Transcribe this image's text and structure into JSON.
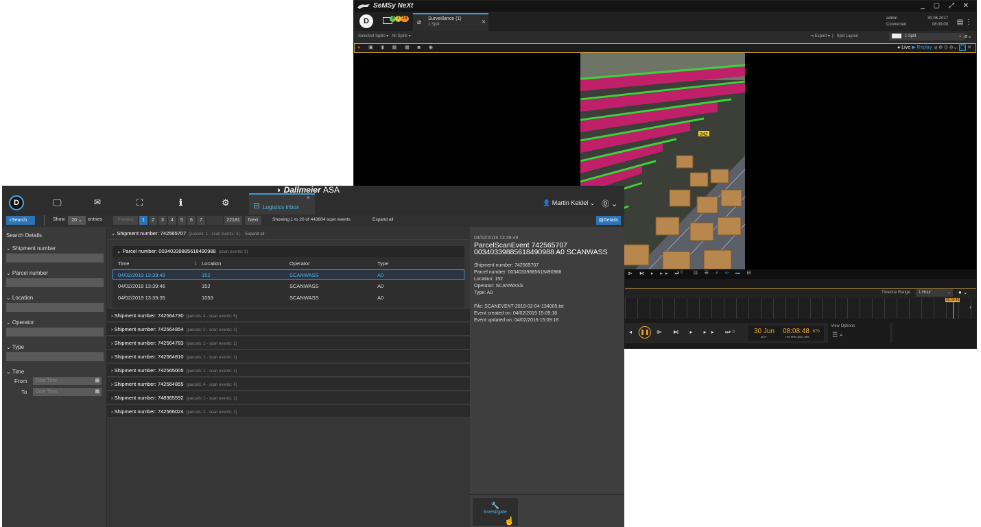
{
  "semsy": {
    "title": "SeMSy NeXt",
    "window_controls": "_ ▢ ⤢ ✕",
    "badges": [
      "3",
      "1",
      "15"
    ],
    "tab": {
      "title": "Surveillance (1)",
      "subtitle": "1 Split"
    },
    "user": {
      "name": "admin",
      "status": "Connected"
    },
    "date": "30.06.2017",
    "time": "08:09:00",
    "selected_splits": "Selected Splits ▾",
    "all_splits": "All Splits ▾",
    "export": "Export ▾",
    "split_layout_label": "Split Layout",
    "split_layout_value": "1 Split",
    "live": "Live",
    "replay": "Replay",
    "shelf_label": "242",
    "speed": "x 0",
    "timeline_range_label": "Timeline Range",
    "timeline_range_value": "1 Hour",
    "timeline_cursor": "08:08:48",
    "view_options": "View Options",
    "play_date": "30 Jun",
    "play_date_sub": "DAY",
    "play_time": "08:08:48",
    "play_ms": ".670",
    "play_time_sub": "HR  MIN  SEC  MS",
    "colors": {
      "accent": "#f0a830",
      "live": "#3b9bd6"
    }
  },
  "dall": {
    "brand": "Dallmeier",
    "brand_suffix": "ASA",
    "nav_icons": [
      "logo-icon",
      "monitor-icon",
      "mail-icon",
      "map-icon",
      "info-icon",
      "gears-icon"
    ],
    "tab_label": "Logistics Inbox",
    "user": "Martin Keidel ⌄",
    "help": "⓪ ⌄",
    "search_btn": "Search",
    "show": "Show",
    "show_value": "20 ⌄",
    "entries": "entries",
    "previous": "Previous",
    "pages": [
      "1",
      "2",
      "3",
      "4",
      "5",
      "6",
      "7"
    ],
    "last_page": "22181",
    "next": "Next",
    "showing": "Showing 1 to 20 of 443604 scan events",
    "expand_all": "Expand all",
    "details_btn": "Details",
    "sidebar": {
      "title": "Search Details",
      "shipment": "⌄ Shipment number",
      "parcel": "⌄ Parcel number",
      "location": "⌄ Location",
      "operator": "⌄ Operator",
      "type": "⌄ Type",
      "time": "⌄ Time",
      "from": "From",
      "to": "To",
      "dt_placeholder": "Date Time"
    },
    "first_shipment": {
      "label": "⌄ Shipment number: 742565707",
      "meta": "(parcels: 1 - scan events: 3)",
      "expand": "Expand all"
    },
    "parcel": {
      "label": "⌄ Parcel number: 00340339885618490988",
      "meta": "(scan events: 3)"
    },
    "columns": [
      "Time",
      "Location",
      "Operator",
      "Type"
    ],
    "rows": [
      {
        "time": "04/02/2019 13:39:49",
        "location": "152",
        "operator": "SCANWASS",
        "type": "A0"
      },
      {
        "time": "04/02/2019 13:39:46",
        "location": "152",
        "operator": "SCANWASS",
        "type": "A0"
      },
      {
        "time": "04/02/2019 13:39:35",
        "location": "1053",
        "operator": "SCANWASS",
        "type": "A0"
      }
    ],
    "shipments": [
      {
        "label": "› Shipment number: 742564730",
        "meta": "(parcels: 4 - scan events: 5)"
      },
      {
        "label": "› Shipment number: 742564854",
        "meta": "(parcels: 2 - scan events: 2)"
      },
      {
        "label": "› Shipment number: 742564783",
        "meta": "(parcels: 1 - scan events: 1)"
      },
      {
        "label": "› Shipment number: 742564810",
        "meta": "(parcels: 1 - scan events: 1)"
      },
      {
        "label": "› Shipment number: 742565005",
        "meta": "(parcels: 1 - scan events: 1)"
      },
      {
        "label": "› Shipment number: 742564855",
        "meta": "(parcels: 4 - scan events: 4)"
      },
      {
        "label": "› Shipment number: 748965592",
        "meta": "(parcels: 1 - scan events: 1)"
      },
      {
        "label": "› Shipment number: 742566024",
        "meta": "(parcels: 2 - scan events: 2)"
      }
    ],
    "details": {
      "ts": "04/02/2019 13:39:49",
      "title1": "ParcelScanEvent 742565707",
      "title2": "00340339885618490988 A0 SCANWASS",
      "lines": [
        "Shipment number: 742565707",
        "Parcel number: 00340339885618490988",
        "Location: 152",
        "Operator: SCANWASS",
        "Type: A0"
      ],
      "file_lines": [
        "File: SCANEVENT-2019-02-04-134005.txt",
        "Event created on: 04/02/2019 15:09:18",
        "Event updated on: 04/02/2019 15:09:18"
      ],
      "investigate": "Investigate"
    }
  }
}
